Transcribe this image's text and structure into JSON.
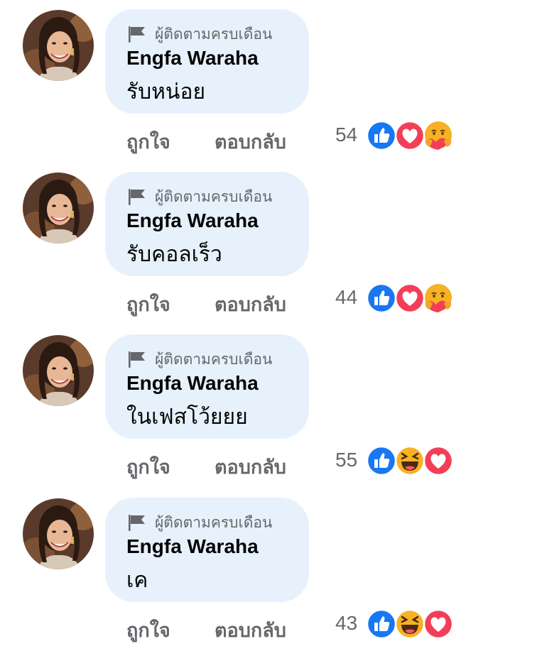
{
  "comments": [
    {
      "badge": "ผู้ติดตามครบเดือน",
      "author": "Engfa Waraha",
      "message": "รับหน่อย",
      "actions": {
        "like": "ถูกใจ",
        "reply": "ตอบกลับ"
      },
      "reaction_count": "54",
      "reactions": [
        "like",
        "love",
        "care"
      ]
    },
    {
      "badge": "ผู้ติดตามครบเดือน",
      "author": "Engfa Waraha",
      "message": "รับคอลเร็ว",
      "actions": {
        "like": "ถูกใจ",
        "reply": "ตอบกลับ"
      },
      "reaction_count": "44",
      "reactions": [
        "like",
        "love",
        "care"
      ]
    },
    {
      "badge": "ผู้ติดตามครบเดือน",
      "author": "Engfa Waraha",
      "message": "ในเฟสโว้ยยย",
      "actions": {
        "like": "ถูกใจ",
        "reply": "ตอบกลับ"
      },
      "reaction_count": "55",
      "reactions": [
        "like",
        "haha",
        "love"
      ]
    },
    {
      "badge": "ผู้ติดตามครบเดือน",
      "author": "Engfa Waraha",
      "message": "เค",
      "actions": {
        "like": "ถูกใจ",
        "reply": "ตอบกลับ"
      },
      "reaction_count": "43",
      "reactions": [
        "like",
        "haha",
        "love"
      ]
    }
  ],
  "colors": {
    "bubble": "#e6f1fc",
    "like_blue": "#1877f2",
    "love_red": "#f33e58",
    "emoji_yellow": "#f7b125",
    "muted_text": "#65676b"
  }
}
